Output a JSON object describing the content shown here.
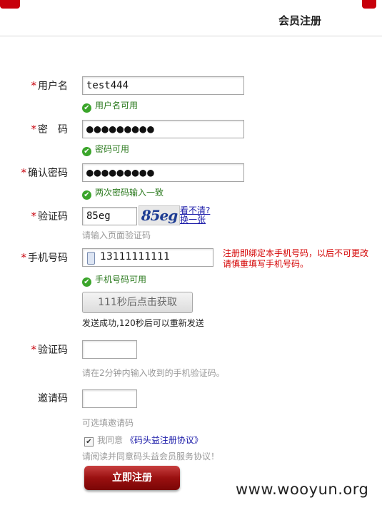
{
  "header": {
    "title": "会员注册"
  },
  "form": {
    "username": {
      "label": "用户名",
      "value": "test444",
      "status": "用户名可用"
    },
    "password": {
      "label": "密　码",
      "value": "●●●●●●●●●",
      "status": "密码可用"
    },
    "confirm": {
      "label": "确认密码",
      "value": "●●●●●●●●●",
      "status": "两次密码输入一致"
    },
    "captcha": {
      "label": "验证码",
      "value": "85eg",
      "image_text": "85eg",
      "refresh_line1": "看不清?",
      "refresh_line2": "换一张",
      "hint": "请输入页面验证码"
    },
    "phone": {
      "label": "手机号码",
      "value": "13111111111",
      "status": "手机号码可用",
      "warning_line1": "注册即绑定本手机号码，以后不可更改",
      "warning_line2": "请慎重填写手机号码。"
    },
    "sms_button": "111秒后点击获取",
    "sms_sent": "发送成功,120秒后可以重新发送",
    "sms_code": {
      "label": "验证码",
      "value": "",
      "hint": "请在2分钟内输入收到的手机验证码。"
    },
    "invite": {
      "label": "邀请码",
      "value": "",
      "hint": "可选填邀请码"
    },
    "agree": {
      "text": "我同意",
      "link": "《码头益注册协议》",
      "checked": true
    },
    "agree_hint": "请阅读并同意码头益会员服务协议！",
    "required_mark": "*",
    "submit": "立即注册"
  },
  "watermark": "www.wooyun.org",
  "colors": {
    "accent": "#c7000b",
    "ok": "#2b7a1e",
    "link": "#1a1aa8",
    "warning": "#d40000"
  }
}
